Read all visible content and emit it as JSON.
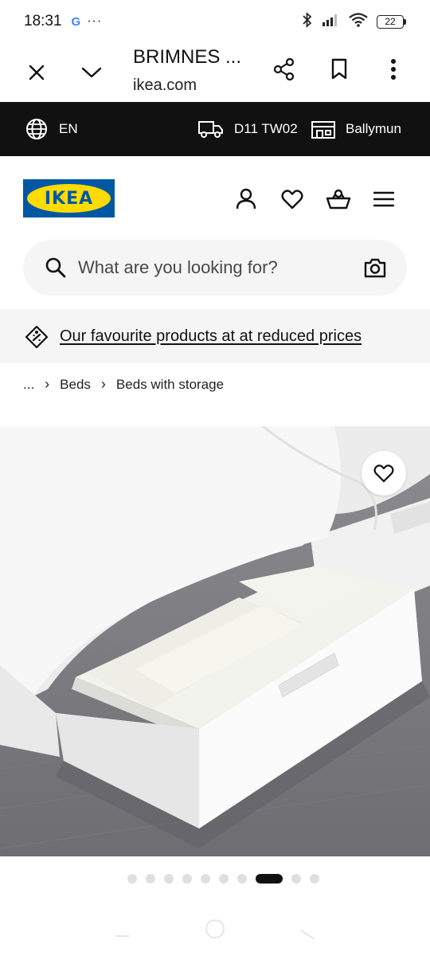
{
  "status_bar": {
    "time": "18:31",
    "google_badge": "G",
    "more": "···",
    "battery_level": "22",
    "icons": [
      "bluetooth-icon",
      "signal-icon",
      "wifi-icon",
      "battery-icon"
    ]
  },
  "browser": {
    "page_title": "BRIMNES ...",
    "domain": "ikea.com",
    "icons": [
      "close-icon",
      "chevron-down-icon",
      "share-icon",
      "bookmark-icon",
      "more-vertical-icon"
    ]
  },
  "location_bar": {
    "language": "EN",
    "postcode": "D11 TW02",
    "store": "Ballymun"
  },
  "header": {
    "logo_text": "IKEA",
    "brand_colors": {
      "blue": "#0058a3",
      "yellow": "#ffdb00"
    }
  },
  "search": {
    "placeholder": "What are you looking for?"
  },
  "promo": {
    "text": "Our favourite products at at reduced prices"
  },
  "breadcrumb": {
    "ellipsis": "...",
    "items": [
      "Beds",
      "Beds with storage"
    ]
  },
  "gallery": {
    "image_subject": "white bed with open storage drawer",
    "total_images": 10,
    "active_index": 7
  }
}
